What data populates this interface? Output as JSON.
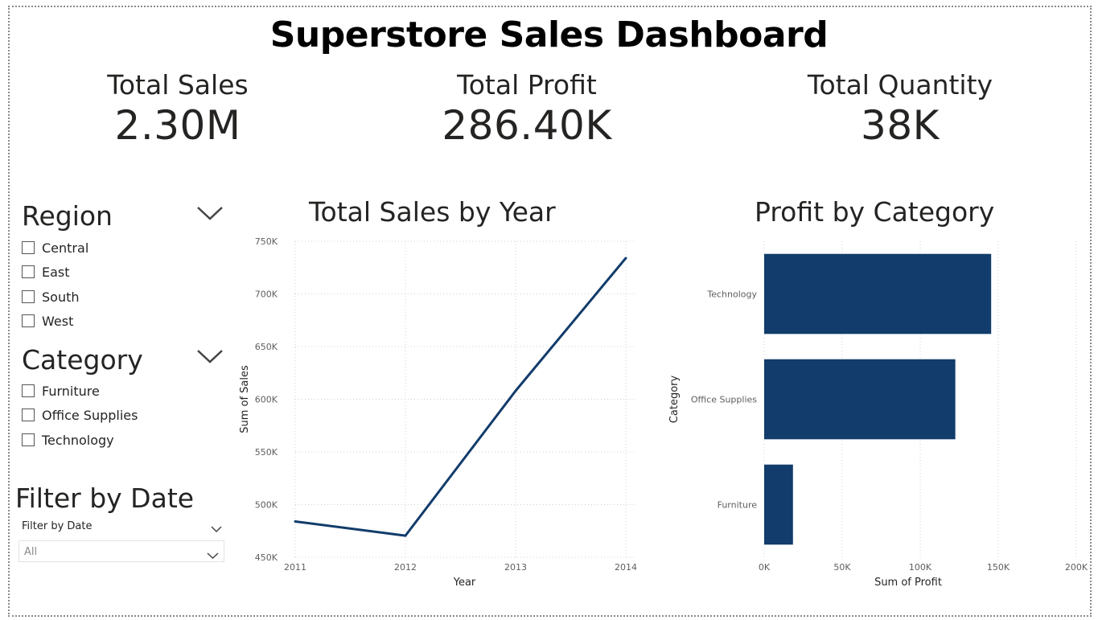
{
  "title": "Superstore Sales Dashboard",
  "kpis": [
    {
      "label": "Total Sales",
      "value": "2.30M"
    },
    {
      "label": "Total Profit",
      "value": "286.40K"
    },
    {
      "label": "Total Quantity",
      "value": "38K"
    }
  ],
  "slicers": {
    "region": {
      "title": "Region",
      "options": [
        "Central",
        "East",
        "South",
        "West"
      ]
    },
    "category": {
      "title": "Category",
      "options": [
        "Furniture",
        "Office Supplies",
        "Technology"
      ]
    },
    "date": {
      "title": "Filter by Date",
      "label": "Filter by Date",
      "selected": "All"
    }
  },
  "colors": {
    "series": "#123c6b",
    "grid": "#d0d0d0",
    "text": "#252423"
  },
  "chart_data": [
    {
      "type": "line",
      "title": "Total Sales by Year",
      "xlabel": "Year",
      "ylabel": "Sum of Sales",
      "x": [
        "2011",
        "2012",
        "2013",
        "2014"
      ],
      "values": [
        484000,
        470500,
        608000,
        734000
      ],
      "ylim": [
        450000,
        750000
      ],
      "yticks": [
        450000,
        500000,
        550000,
        600000,
        650000,
        700000,
        750000
      ],
      "ytick_labels": [
        "450K",
        "500K",
        "550K",
        "600K",
        "650K",
        "700K",
        "750K"
      ],
      "grid": true
    },
    {
      "type": "bar",
      "orientation": "horizontal",
      "title": "Profit by Category",
      "xlabel": "Sum of Profit",
      "ylabel": "Category",
      "categories": [
        "Technology",
        "Office Supplies",
        "Furniture"
      ],
      "values": [
        145455,
        122491,
        18451
      ],
      "xlim": [
        0,
        200000
      ],
      "xticks": [
        0,
        50000,
        100000,
        150000,
        200000
      ],
      "xtick_labels": [
        "0K",
        "50K",
        "100K",
        "150K",
        "200K"
      ],
      "grid": true
    }
  ]
}
